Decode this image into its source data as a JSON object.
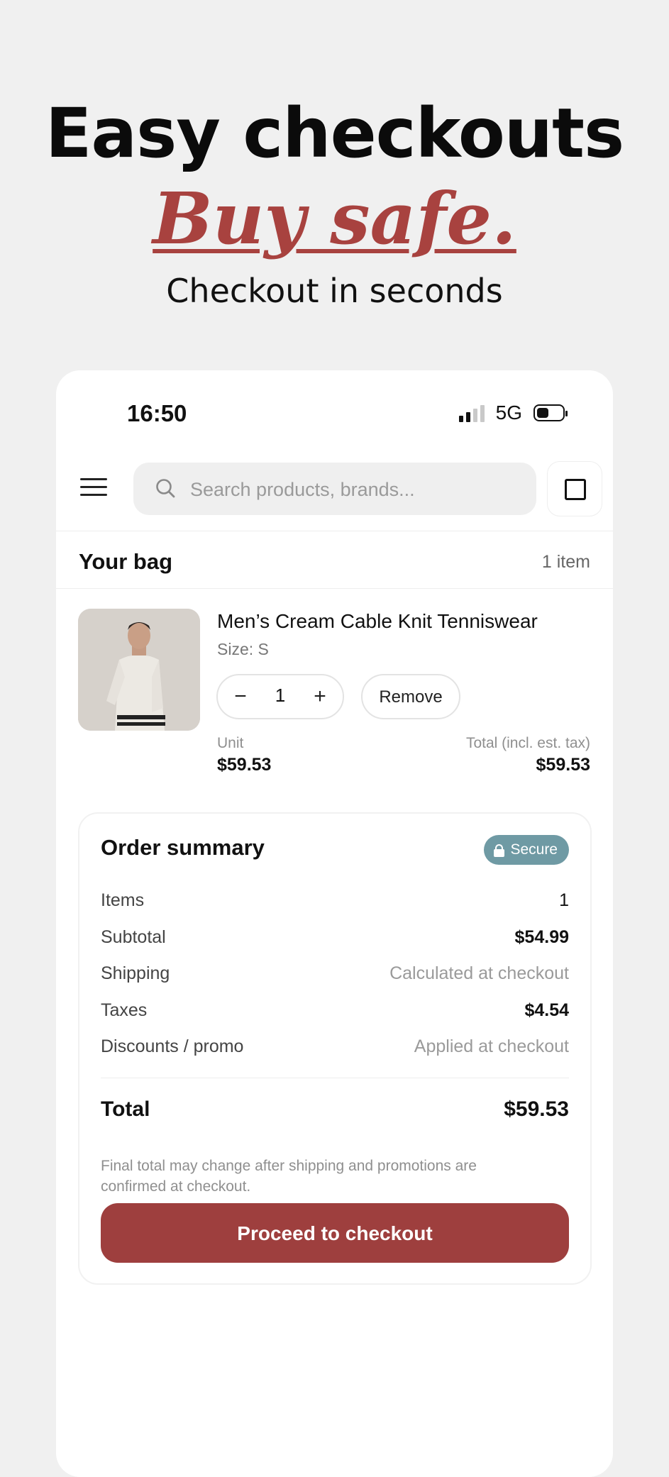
{
  "hero": {
    "title": "Easy checkouts",
    "accent": "Buy safe.",
    "subtitle": "Checkout in seconds"
  },
  "status_bar": {
    "time": "16:50",
    "network": "5G",
    "signal_bars_active": 2,
    "signal_bars_total": 4
  },
  "header": {
    "search_placeholder": "Search products, brands...",
    "menu_icon": "hamburger-menu-icon",
    "search_icon": "search-icon",
    "square_icon": "square-icon"
  },
  "bag": {
    "title": "Your bag",
    "count": "1 item"
  },
  "cart_item": {
    "name": "Men’s Cream Cable Knit Tenniswear",
    "size": "Size: S",
    "quantity": "1",
    "minus": "−",
    "plus": "+",
    "remove_label": "Remove",
    "unit_label": "Unit",
    "unit_price": "$59.53",
    "total_label": "Total (incl. est. tax)",
    "total_price": "$59.53"
  },
  "summary": {
    "title": "Order summary",
    "secure_label": "Secure",
    "rows": [
      {
        "label": "Items",
        "value": "1"
      },
      {
        "label": "Subtotal",
        "value": "$54.99"
      },
      {
        "label": "Shipping",
        "value": "Calculated at checkout"
      },
      {
        "label": "Taxes",
        "value": "$4.54"
      },
      {
        "label": "Discounts / promo",
        "value": "Applied at checkout"
      }
    ],
    "total_label": "Total",
    "total_value": "$59.53",
    "note": "Final total may change after shipping and promotions are confirmed at checkout.",
    "cta_label": "Proceed to checkout"
  },
  "colors": {
    "accent": "#a8423f",
    "cta": "#9e3f3e",
    "secure_badge": "#6f9aa4",
    "background": "#f0f0f0"
  }
}
